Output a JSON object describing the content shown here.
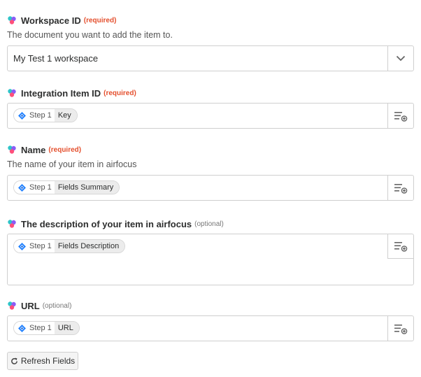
{
  "fields": {
    "workspace": {
      "label": "Workspace ID",
      "tag": "(required)",
      "help": "The document you want to add the item to.",
      "value": "My Test 1 workspace"
    },
    "integration": {
      "label": "Integration Item ID",
      "tag": "(required)",
      "step": "Step 1",
      "value": "Key"
    },
    "name": {
      "label": "Name",
      "tag": "(required)",
      "help": "The name of your item in airfocus",
      "step": "Step 1",
      "value": "Fields Summary"
    },
    "description": {
      "label": "The description of your item in airfocus",
      "tag": "(optional)",
      "step": "Step 1",
      "value": "Fields Description"
    },
    "url": {
      "label": "URL",
      "tag": "(optional)",
      "step": "Step 1",
      "value": "URL"
    }
  },
  "refresh_label": "Refresh Fields",
  "colors": {
    "required": "#e44f2d",
    "jira_blue": "#2684ff",
    "border": "#cfcfcf"
  },
  "icons": {
    "app": "airfocus-icon",
    "step": "jira-icon",
    "insert": "insert-data-icon",
    "dropdown": "chevron-down-icon",
    "refresh": "refresh-icon"
  }
}
